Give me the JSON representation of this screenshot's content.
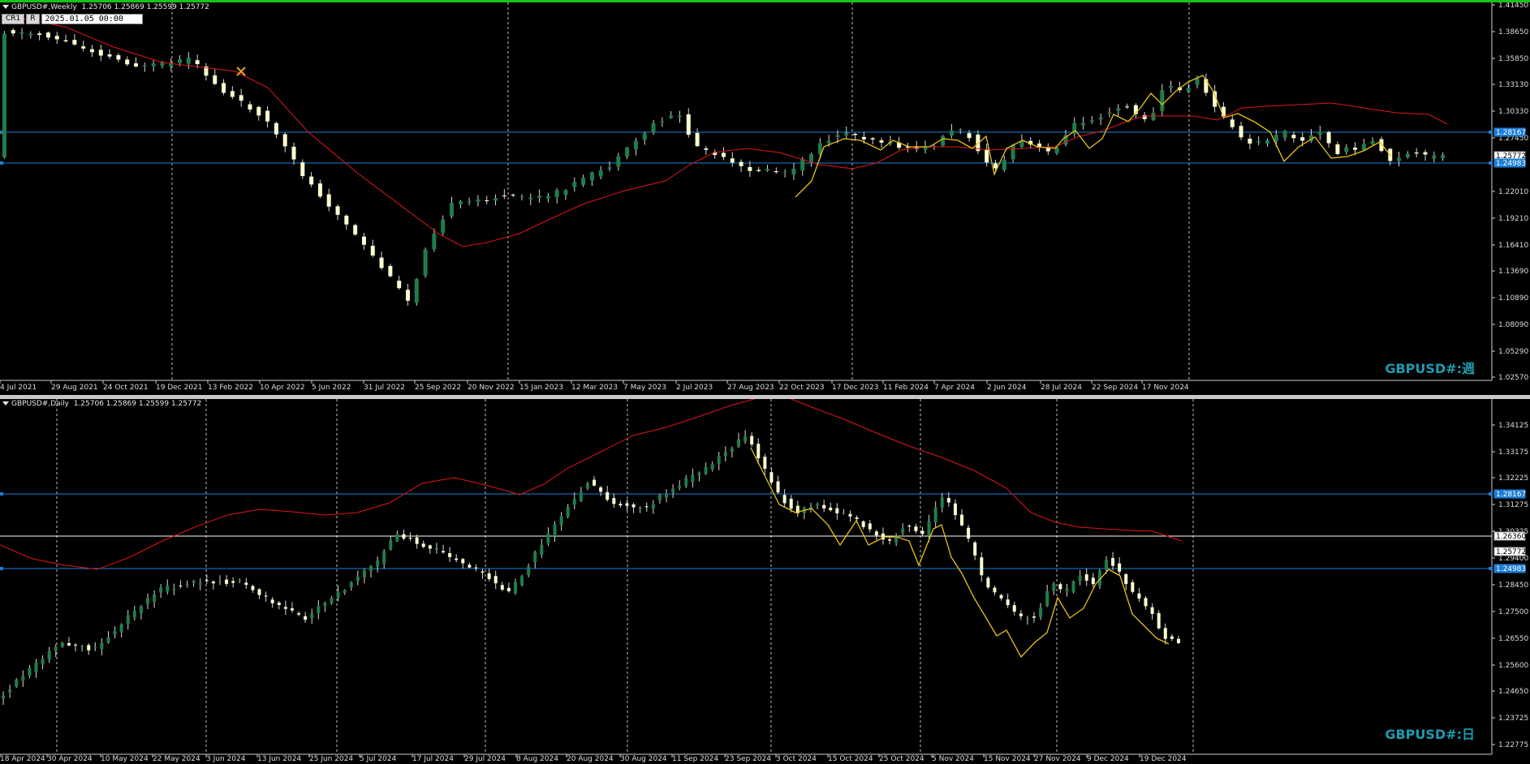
{
  "colors": {
    "background": "#000000",
    "top_border": "#19c119",
    "bull_body": "#1f7d4a",
    "bear_body": "#fffdd0",
    "wick": "#d9d9d9",
    "ma_line": "#e0161c",
    "zigzag": "#e8c21a",
    "hline_blue": "#1c7ed6",
    "hline_white": "#ffffff",
    "grid": "#bfbfbf",
    "axis_text": "#dcdcdc",
    "watermark": "#1d9bb0"
  },
  "weekly": {
    "header_title": "GBPUSD#,Weekly",
    "header_ohlc": "1.25706 1.25869 1.25599 1.25772",
    "quickbar": {
      "btn1": "CR1",
      "btn2": "R",
      "date_value": "2025.01.05 00:00"
    },
    "watermark": "GBPUSD#:週",
    "drawing_icon": "crossed-tools-icon",
    "price_labels": [
      "1.41450",
      "1.38650",
      "1.35850",
      "1.33130",
      "1.30330",
      "1.27450",
      "1.22010",
      "1.19210",
      "1.16410",
      "1.13690",
      "1.10890",
      "1.08090",
      "1.05290",
      "1.02570"
    ],
    "price_tags": [
      {
        "value": "1.28167",
        "style": "blue"
      },
      {
        "value": "1.25772",
        "style": "white"
      },
      {
        "value": "1.24983",
        "style": "blue"
      }
    ],
    "time_labels": [
      "4 Jul 2021",
      "29 Aug 2021",
      "24 Oct 2021",
      "19 Dec 2021",
      "13 Feb 2022",
      "10 Apr 2022",
      "5 Jun 2022",
      "31 Jul 2022",
      "25 Sep 2022",
      "20 Nov 2022",
      "15 Jan 2023",
      "12 Mar 2023",
      "7 May 2023",
      "2 Jul 2023",
      "27 Aug 2023",
      "22 Oct 2023",
      "17 Dec 2023",
      "11 Feb 2024",
      "7 Apr 2024",
      "2 Jun 2024",
      "28 Jul 2024",
      "22 Sep 2024",
      "17 Nov 2024"
    ]
  },
  "daily": {
    "header_title": "GBPUSD#,Daily",
    "header_ohlc": "1.25706 1.25869 1.25599 1.25772",
    "watermark": "GBPUSD#:日",
    "price_labels": [
      "1.34125",
      "1.33175",
      "1.32225",
      "1.31275",
      "1.30325",
      "1.29400",
      "1.28450",
      "1.27500",
      "1.26550",
      "1.25600",
      "1.24650",
      "1.23725",
      "1.22775"
    ],
    "price_tags": [
      {
        "value": "1.28167",
        "style": "blue"
      },
      {
        "value": "1.26360",
        "style": "white"
      },
      {
        "value": "1.25772",
        "style": "white"
      },
      {
        "value": "1.24983",
        "style": "blue"
      }
    ],
    "time_labels": [
      "18 Apr 2024",
      "30 Apr 2024",
      "10 May 2024",
      "22 May 2024",
      "3 Jun 2024",
      "13 Jun 2024",
      "25 Jun 2024",
      "5 Jul 2024",
      "17 Jul 2024",
      "29 Jul 2024",
      "8 Aug 2024",
      "20 Aug 2024",
      "30 Aug 2024",
      "11 Sep 2024",
      "23 Sep 2024",
      "3 Oct 2024",
      "15 Oct 2024",
      "25 Oct 2024",
      "5 Nov 2024",
      "15 Nov 2024",
      "27 Nov 2024",
      "9 Dec 2024",
      "19 Dec 2024"
    ]
  }
}
